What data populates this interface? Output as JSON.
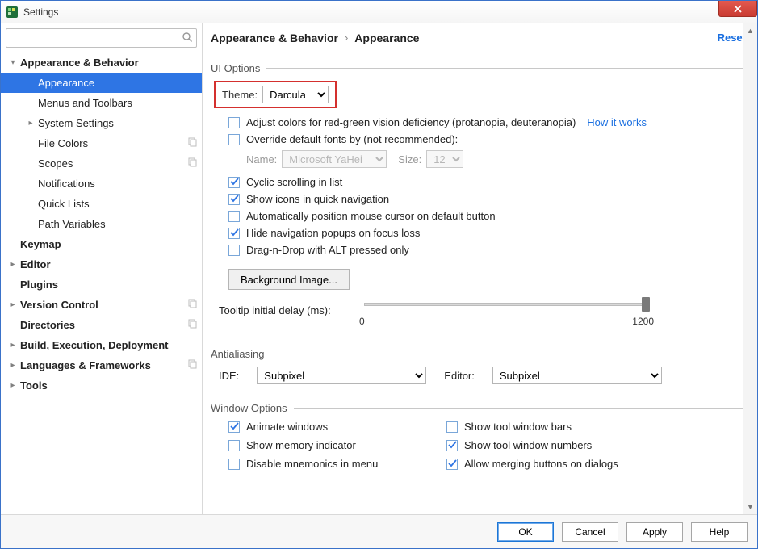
{
  "window": {
    "title": "Settings"
  },
  "header": {
    "crumb1": "Appearance & Behavior",
    "crumb2": "Appearance",
    "reset": "Reset"
  },
  "search": {
    "placeholder": ""
  },
  "tree": [
    {
      "label": "Appearance & Behavior",
      "level": 0,
      "bold": true,
      "arrow": "down",
      "selected": false,
      "copy": false
    },
    {
      "label": "Appearance",
      "level": 1,
      "bold": false,
      "arrow": "",
      "selected": true,
      "copy": false
    },
    {
      "label": "Menus and Toolbars",
      "level": 1,
      "bold": false,
      "arrow": "",
      "selected": false,
      "copy": false
    },
    {
      "label": "System Settings",
      "level": 1,
      "bold": false,
      "arrow": "right",
      "selected": false,
      "copy": false
    },
    {
      "label": "File Colors",
      "level": 1,
      "bold": false,
      "arrow": "",
      "selected": false,
      "copy": true
    },
    {
      "label": "Scopes",
      "level": 1,
      "bold": false,
      "arrow": "",
      "selected": false,
      "copy": true
    },
    {
      "label": "Notifications",
      "level": 1,
      "bold": false,
      "arrow": "",
      "selected": false,
      "copy": false
    },
    {
      "label": "Quick Lists",
      "level": 1,
      "bold": false,
      "arrow": "",
      "selected": false,
      "copy": false
    },
    {
      "label": "Path Variables",
      "level": 1,
      "bold": false,
      "arrow": "",
      "selected": false,
      "copy": false
    },
    {
      "label": "Keymap",
      "level": 0,
      "bold": true,
      "arrow": "",
      "selected": false,
      "copy": false
    },
    {
      "label": "Editor",
      "level": 0,
      "bold": true,
      "arrow": "right",
      "selected": false,
      "copy": false
    },
    {
      "label": "Plugins",
      "level": 0,
      "bold": true,
      "arrow": "",
      "selected": false,
      "copy": false
    },
    {
      "label": "Version Control",
      "level": 0,
      "bold": true,
      "arrow": "right",
      "selected": false,
      "copy": true
    },
    {
      "label": "Directories",
      "level": 0,
      "bold": true,
      "arrow": "",
      "selected": false,
      "copy": true
    },
    {
      "label": "Build, Execution, Deployment",
      "level": 0,
      "bold": true,
      "arrow": "right",
      "selected": false,
      "copy": false
    },
    {
      "label": "Languages & Frameworks",
      "level": 0,
      "bold": true,
      "arrow": "right",
      "selected": false,
      "copy": true
    },
    {
      "label": "Tools",
      "level": 0,
      "bold": true,
      "arrow": "right",
      "selected": false,
      "copy": false
    }
  ],
  "ui": {
    "section": "UI Options",
    "themeLabel": "Theme:",
    "themeValue": "Darcula",
    "opts": [
      {
        "label": "Adjust colors for red-green vision deficiency (protanopia, deuteranopia)",
        "checked": false,
        "link": "How it works"
      },
      {
        "label": "Override default fonts by (not recommended):",
        "checked": false
      }
    ],
    "fontNameLabel": "Name:",
    "fontNameValue": "Microsoft YaHei",
    "fontSizeLabel": "Size:",
    "fontSizeValue": "12",
    "opts2": [
      {
        "label": "Cyclic scrolling in list",
        "checked": true
      },
      {
        "label": "Show icons in quick navigation",
        "checked": true
      },
      {
        "label": "Automatically position mouse cursor on default button",
        "checked": false
      },
      {
        "label": "Hide navigation popups on focus loss",
        "checked": true
      },
      {
        "label": "Drag-n-Drop with ALT pressed only",
        "checked": false
      }
    ],
    "bgImageBtn": "Background Image...",
    "tooltipLabel": "Tooltip initial delay (ms):",
    "tooltipMin": "0",
    "tooltipMax": "1200"
  },
  "aa": {
    "section": "Antialiasing",
    "ideLabel": "IDE:",
    "ideValue": "Subpixel",
    "editorLabel": "Editor:",
    "editorValue": "Subpixel"
  },
  "win": {
    "section": "Window Options",
    "items": [
      {
        "label": "Animate windows",
        "checked": true
      },
      {
        "label": "Show tool window bars",
        "checked": false
      },
      {
        "label": "Show memory indicator",
        "checked": false
      },
      {
        "label": "Show tool window numbers",
        "checked": true
      },
      {
        "label": "Disable mnemonics in menu",
        "checked": false
      },
      {
        "label": "Allow merging buttons on dialogs",
        "checked": true
      }
    ]
  },
  "footer": {
    "ok": "OK",
    "cancel": "Cancel",
    "apply": "Apply",
    "help": "Help"
  }
}
